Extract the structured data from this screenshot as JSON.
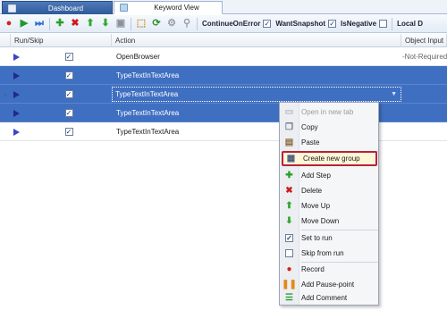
{
  "tabs": [
    {
      "label": "Dashboard",
      "active": false
    },
    {
      "label": "Keyword View",
      "active": true
    }
  ],
  "toolbar": {
    "icons": [
      "record-icon",
      "run-icon",
      "run-from-step-icon",
      "add-step-icon",
      "delete-icon",
      "move-up-icon",
      "move-down-icon",
      "save-icon",
      "lock-icon",
      "refresh-icon",
      "tools-icon",
      "search-icon"
    ],
    "continue_on_error": {
      "label": "ContinueOnError",
      "checked": true
    },
    "want_snapshot": {
      "label": "WantSnapshot",
      "checked": true
    },
    "is_negative": {
      "label": "IsNegative",
      "checked": false
    },
    "local_label": "Local D"
  },
  "grid": {
    "headers": {
      "run_skip": "Run/Skip",
      "action": "Action",
      "object_input": "Object Input"
    },
    "rows": [
      {
        "action": "OpenBrowser",
        "object": "-Not-Required-",
        "run": true,
        "selected": false
      },
      {
        "action": "TypeTextInTextArea",
        "object": "",
        "run": true,
        "selected": true
      },
      {
        "action": "TypeTextInTextArea",
        "object": "",
        "run": true,
        "selected": true,
        "current": true
      },
      {
        "action": "TypeTextInTextArea",
        "object": "",
        "run": true,
        "selected": true
      },
      {
        "action": "TypeTextInTextArea",
        "object": "",
        "run": true,
        "selected": false
      }
    ]
  },
  "context_menu": {
    "items": [
      {
        "label": "Open in new tab",
        "icon": "open-tab-icon",
        "disabled": true
      },
      {
        "label": "Copy",
        "icon": "copy-icon"
      },
      {
        "label": "Paste",
        "icon": "paste-icon"
      },
      {
        "label": "Create new group",
        "icon": "group-icon",
        "highlighted": true
      },
      {
        "label": "Add Step",
        "icon": "add-icon"
      },
      {
        "label": "Delete",
        "icon": "delete-icon"
      },
      {
        "label": "Move Up",
        "icon": "move-up-icon"
      },
      {
        "label": "Move Down",
        "icon": "move-down-icon"
      },
      {
        "label": "Set to run",
        "icon": "checkbox-checked-icon"
      },
      {
        "label": "Skip from run",
        "icon": "checkbox-empty-icon"
      },
      {
        "label": "Record",
        "icon": "record-icon"
      },
      {
        "label": "Add Pause-point",
        "icon": "pause-icon"
      },
      {
        "label": "Add Comment",
        "icon": "comment-icon"
      }
    ]
  },
  "colors": {
    "selection": "#3f6fc1",
    "highlight_border": "#b5233a",
    "tab_active_bg": "#2f5a9a"
  }
}
